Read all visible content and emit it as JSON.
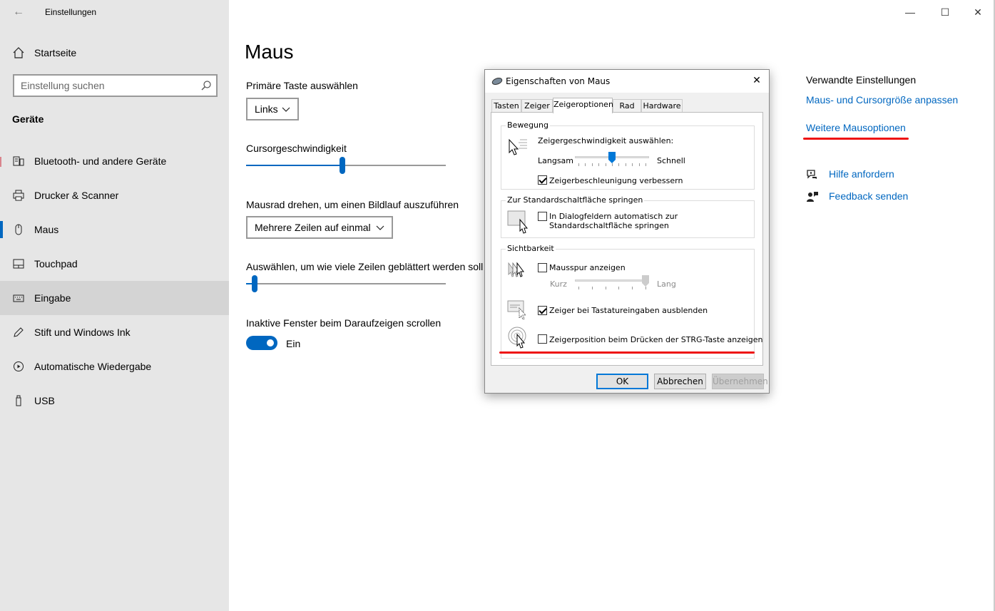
{
  "window": {
    "app_title": "Einstellungen",
    "back_glyph": "←",
    "minimize_glyph": "—",
    "maximize_glyph": "☐",
    "close_glyph": "✕"
  },
  "sidebar": {
    "home_label": "Startseite",
    "search_placeholder": "Einstellung suchen",
    "section_title": "Geräte",
    "items": [
      {
        "label": "Bluetooth- und andere Geräte",
        "icon": "bluetooth-devices-icon"
      },
      {
        "label": "Drucker & Scanner",
        "icon": "printer-icon"
      },
      {
        "label": "Maus",
        "icon": "mouse-icon",
        "selected": true
      },
      {
        "label": "Touchpad",
        "icon": "touchpad-icon"
      },
      {
        "label": "Eingabe",
        "icon": "keyboard-icon"
      },
      {
        "label": "Stift und Windows Ink",
        "icon": "pen-icon"
      },
      {
        "label": "Automatische Wiedergabe",
        "icon": "autoplay-icon"
      },
      {
        "label": "USB",
        "icon": "usb-icon"
      }
    ]
  },
  "main": {
    "page_title": "Maus",
    "primary_button_label": "Primäre Taste auswählen",
    "primary_button_value": "Links",
    "cursor_speed_label": "Cursorgeschwindigkeit",
    "cursor_speed_fraction": 0.48,
    "wheel_label": "Mausrad drehen, um einen Bildlauf auszuführen",
    "wheel_value": "Mehrere Zeilen auf einmal",
    "lines_label": "Auswählen, um wie viele Zeilen geblättert werden soll",
    "lines_fraction": 0.03,
    "inactive_scroll_label": "Inaktive Fenster beim Daraufzeigen scrollen",
    "inactive_scroll_state": "Ein",
    "accent_color": "#0067c0"
  },
  "related": {
    "heading": "Verwandte Einstellungen",
    "link_cursor_size": "Maus- und Cursorgröße anpassen",
    "link_more_options": "Weitere Mausoptionen",
    "help_label": "Hilfe anfordern",
    "feedback_label": "Feedback senden"
  },
  "dialog": {
    "title": "Eigenschaften von Maus",
    "close_glyph": "✕",
    "tabs": [
      "Tasten",
      "Zeiger",
      "Zeigeroptionen",
      "Rad",
      "Hardware"
    ],
    "active_tab": "Zeigeroptionen",
    "motion": {
      "group_title": "Bewegung",
      "speed_caption": "Zeigergeschwindigkeit auswählen:",
      "slow_label": "Langsam",
      "fast_label": "Schnell",
      "speed_fraction": 0.5,
      "enhance_precision_label": "Zeigerbeschleunigung verbessern",
      "enhance_precision_checked": true
    },
    "snap_to": {
      "group_title": "Zur Standardschaltfläche springen",
      "label": "In Dialogfeldern automatisch zur Standardschaltfläche springen",
      "checked": false
    },
    "visibility": {
      "group_title": "Sichtbarkeit",
      "trails_label": "Mausspur anzeigen",
      "trails_checked": false,
      "short_label": "Kurz",
      "long_label": "Lang",
      "trails_fraction": 1.0,
      "hide_typing_label": "Zeiger bei Tastatureingaben ausblenden",
      "hide_typing_checked": true,
      "ctrl_location_label": "Zeigerposition beim Drücken der STRG-Taste anzeigen",
      "ctrl_location_checked": false
    },
    "buttons": {
      "ok": "OK",
      "cancel": "Abbrechen",
      "apply": "Übernehmen"
    }
  },
  "annotation_color": "#e11111"
}
